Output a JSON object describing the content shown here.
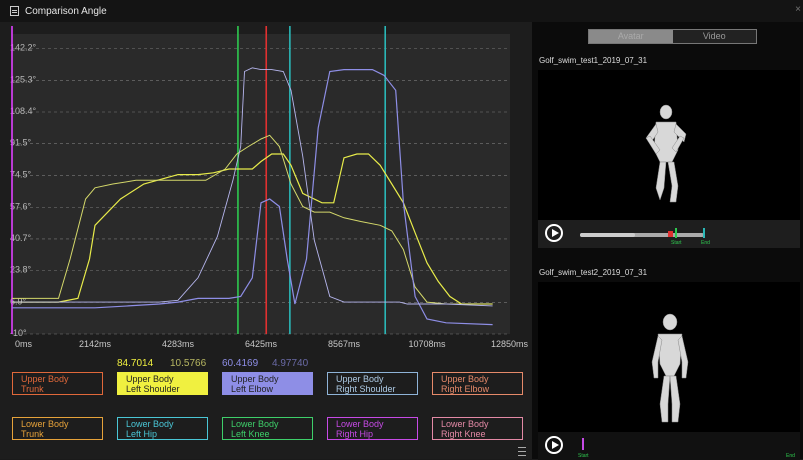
{
  "window": {
    "title": "Comparison Angle",
    "close_glyph": "×"
  },
  "chart": {
    "y_ticks": [
      "142.2°",
      "125.3°",
      "108.4°",
      "91.5°",
      "74.5°",
      "57.6°",
      "40.7°",
      "23.8°",
      "6.9°",
      "-10°"
    ],
    "x_ticks": [
      "0ms",
      "2142ms",
      "4283ms",
      "6425ms",
      "8567ms",
      "10708ms",
      "12850ms"
    ],
    "markers": [
      {
        "name": "magenta",
        "t": 0,
        "color": "#e040ff"
      },
      {
        "name": "green",
        "t": 5830,
        "color": "#2ec94f"
      },
      {
        "name": "red",
        "t": 6560,
        "color": "#e23030"
      },
      {
        "name": "teal",
        "t": 7170,
        "color": "#2ab7b7"
      },
      {
        "name": "teal2",
        "t": 9630,
        "color": "#2ab7b7"
      }
    ]
  },
  "chart_data": {
    "type": "line",
    "xlim": [
      0,
      12850
    ],
    "ylim": [
      -10,
      150
    ],
    "series": [
      {
        "color": "#e8ec4a",
        "width": 1.2,
        "x": [
          0,
          1200,
          1700,
          2000,
          2142,
          2800,
          3400,
          4283,
          4800,
          5200,
          5600,
          5900,
          6200,
          6425,
          6700,
          7000,
          7200,
          7500,
          8000,
          8300,
          8567,
          8900,
          9200,
          9500,
          9800,
          10100,
          10400,
          10708,
          11000,
          11300,
          11600,
          12400
        ],
        "y": [
          7,
          7,
          9,
          30,
          48,
          62,
          70,
          75,
          75,
          76,
          78,
          78,
          78,
          82,
          86,
          86,
          80,
          65,
          60,
          60,
          84,
          86,
          86,
          80,
          70,
          60,
          44,
          28,
          18,
          10,
          6,
          6
        ]
      },
      {
        "color": "#d4d86a",
        "width": 1,
        "x": [
          0,
          1200,
          1500,
          1900,
          2142,
          2600,
          3200,
          3800,
          4283,
          5000,
          5500,
          5800,
          6100,
          6425,
          6650,
          6900,
          7200,
          7500,
          7800,
          8200,
          8567,
          9000,
          9500,
          9800,
          10100,
          10400,
          10708,
          11200,
          11700,
          12400
        ],
        "y": [
          9,
          9,
          30,
          62,
          68,
          70,
          72,
          72,
          72,
          72,
          78,
          86,
          90,
          94,
          96,
          90,
          70,
          58,
          55,
          55,
          52,
          50,
          48,
          45,
          35,
          15,
          7,
          6,
          6,
          6
        ]
      },
      {
        "color": "#8e8ee6",
        "width": 1.2,
        "x": [
          0,
          1500,
          2142,
          3000,
          3800,
          4283,
          4800,
          5200,
          5600,
          5900,
          6200,
          6425,
          6650,
          6900,
          7100,
          7300,
          7600,
          7900,
          8200,
          8567,
          8900,
          9300,
          9600,
          9900,
          10100,
          10400,
          10708,
          11200,
          12400
        ],
        "y": [
          4,
          4,
          4,
          5,
          6,
          7,
          9,
          9,
          9,
          10,
          20,
          60,
          62,
          58,
          30,
          6,
          30,
          100,
          130,
          131,
          131,
          131,
          128,
          120,
          60,
          10,
          -2,
          -4,
          -5
        ]
      },
      {
        "color": "#b6b6ee",
        "width": 0.9,
        "x": [
          0,
          1500,
          2142,
          3000,
          3800,
          4283,
          4800,
          5300,
          5700,
          5900,
          6000,
          6200,
          6425,
          6700,
          7000,
          7200,
          7500,
          7800,
          8200,
          8567,
          9000,
          9600,
          10000,
          10200,
          10500,
          10708,
          11200,
          12400
        ],
        "y": [
          7,
          7,
          7,
          7,
          7,
          8,
          20,
          42,
          72,
          90,
          130,
          132,
          131,
          131,
          130,
          120,
          85,
          40,
          10,
          7,
          7,
          7,
          7,
          6,
          6,
          6,
          6,
          5
        ]
      }
    ]
  },
  "values": {
    "v1": "84.7014",
    "v2": "10.5766",
    "v3": "60.4169",
    "v4": "4.97740"
  },
  "body_buttons": [
    {
      "name": "upper-trunk",
      "line1": "Upper Body",
      "line2": "Trunk",
      "border": "#e0683a",
      "text": "#e0683a",
      "fill": "transparent",
      "active": false
    },
    {
      "name": "upper-left-shoulder",
      "line1": "Upper Body",
      "line2": "Left Shoulder",
      "border": "#f0f040",
      "text": "#222",
      "fill": "#f0f040",
      "active": true
    },
    {
      "name": "upper-left-elbow",
      "line1": "Upper Body",
      "line2": "Left Elbow",
      "border": "#8e8ee6",
      "text": "#222",
      "fill": "#8e8ee6",
      "active": true
    },
    {
      "name": "upper-right-shoulder",
      "line1": "Upper Body",
      "line2": "Right Shoulder",
      "border": "#8fb4d8",
      "text": "#aecbe6",
      "fill": "transparent",
      "active": false
    },
    {
      "name": "upper-right-elbow",
      "line1": "Upper Body",
      "line2": "Right Elbow",
      "border": "#e68a6a",
      "text": "#e68a6a",
      "fill": "transparent",
      "active": false
    },
    {
      "name": "lower-trunk",
      "line1": "Lower Body",
      "line2": "Trunk",
      "border": "#e6a23a",
      "text": "#e6a23a",
      "fill": "transparent",
      "active": false
    },
    {
      "name": "lower-left-hip",
      "line1": "Lower Body",
      "line2": "Left Hip",
      "border": "#4ac6d6",
      "text": "#4ac6d6",
      "fill": "transparent",
      "active": false
    },
    {
      "name": "lower-left-knee",
      "line1": "Lower Body",
      "line2": "Left Knee",
      "border": "#3ecf6a",
      "text": "#3ecf6a",
      "fill": "transparent",
      "active": false
    },
    {
      "name": "lower-right-hip",
      "line1": "Lower Body",
      "line2": "Right Hip",
      "border": "#c64ae6",
      "text": "#c64ae6",
      "fill": "transparent",
      "active": false
    },
    {
      "name": "lower-right-knee",
      "line1": "Lower Body",
      "line2": "Right Knee",
      "border": "#e48aa6",
      "text": "#e48aa6",
      "fill": "transparent",
      "active": false
    }
  ],
  "right_panel": {
    "toggle": {
      "avatar": "Avatar",
      "video": "Video",
      "selected": "Avatar"
    },
    "clip1": {
      "name": "Golf_swim_test1_2019_07_31",
      "start_label": "Start",
      "end_label": "End",
      "progress": 0.44
    },
    "clip2": {
      "name": "Golf_swim_test2_2019_07_31",
      "start_label": "Start",
      "end_label": "End"
    }
  }
}
